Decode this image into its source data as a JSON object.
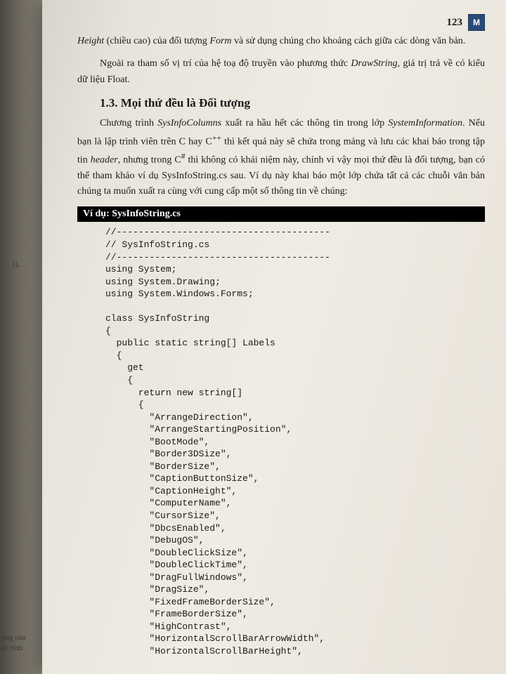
{
  "pageNumber": "123",
  "logo": "M",
  "para1_a": "Height",
  "para1_b": " (chiều cao) của đối tượng ",
  "para1_c": "Form",
  "para1_d": " và sử dụng chúng cho khoảng cách giữa các dòng văn bản.",
  "para2_a": "Ngoài ra tham số vị trí của hệ toạ độ truyền vào phương thức ",
  "para2_b": "DrawString",
  "para2_c": ", giá trị trả về có kiểu dữ liệu Float.",
  "sectionHead": "1.3. Mọi thứ đều là Đối tượng",
  "para3_a": "Chương trình ",
  "para3_b": "SysInfoColumns",
  "para3_c": " xuất ra hầu hết các thông tin trong lớp ",
  "para3_d": "SystemInformation",
  "para3_e": ". Nếu bạn là lập trình viên trên C hay C",
  "para3_f": "++",
  "para3_g": " thì kết quả này sẽ chứa trong mảng và lưu các khai báo trong tập tin ",
  "para3_h": "header",
  "para3_i": ", nhưng trong C",
  "para3_j": "#",
  "para3_k": " thì không có khái niệm này, chính vì vậy mọi thứ đều là đối tượng, bạn có thể tham khảo ví dụ SysInfoString.cs sau. Ví dụ này khai báo một lớp chứa tất cả các chuỗi văn bản chúng ta muốn xuất ra  cùng với cung cấp một số thông tin về chúng:",
  "codeBarLabel": "Ví dụ: SysInfoString.cs",
  "code": "//---------------------------------------\n// SysInfoString.cs\n//---------------------------------------\nusing System;\nusing System.Drawing;\nusing System.Windows.Forms;\n\nclass SysInfoString\n{\n  public static string[] Labels\n  {\n    get\n    {\n      return new string[]\n      {\n        \"ArrangeDirection\",\n        \"ArrangeStartingPosition\",\n        \"BootMode\",\n        \"Border3DSize\",\n        \"BorderSize\",\n        \"CaptionButtonSize\",\n        \"CaptionHeight\",\n        \"ComputerName\",\n        \"CursorSize\",\n        \"DbcsEnabled\",\n        \"DebugOS\",\n        \"DoubleClickSize\",\n        \"DoubleClickTime\",\n        \"DragFullWindows\",\n        \"DragSize\",\n        \"FixedFrameBorderSize\",\n        \"FrameBorderSize\",\n        \"HighContrast\",\n        \"HorizontalScrollBarArrowWidth\",\n        \"HorizontalScrollBarHeight\",",
  "edgeFrag1a": "ộng của",
  "edgeFrag1b": "ộc tính",
  "edgeFrag2": "(),"
}
